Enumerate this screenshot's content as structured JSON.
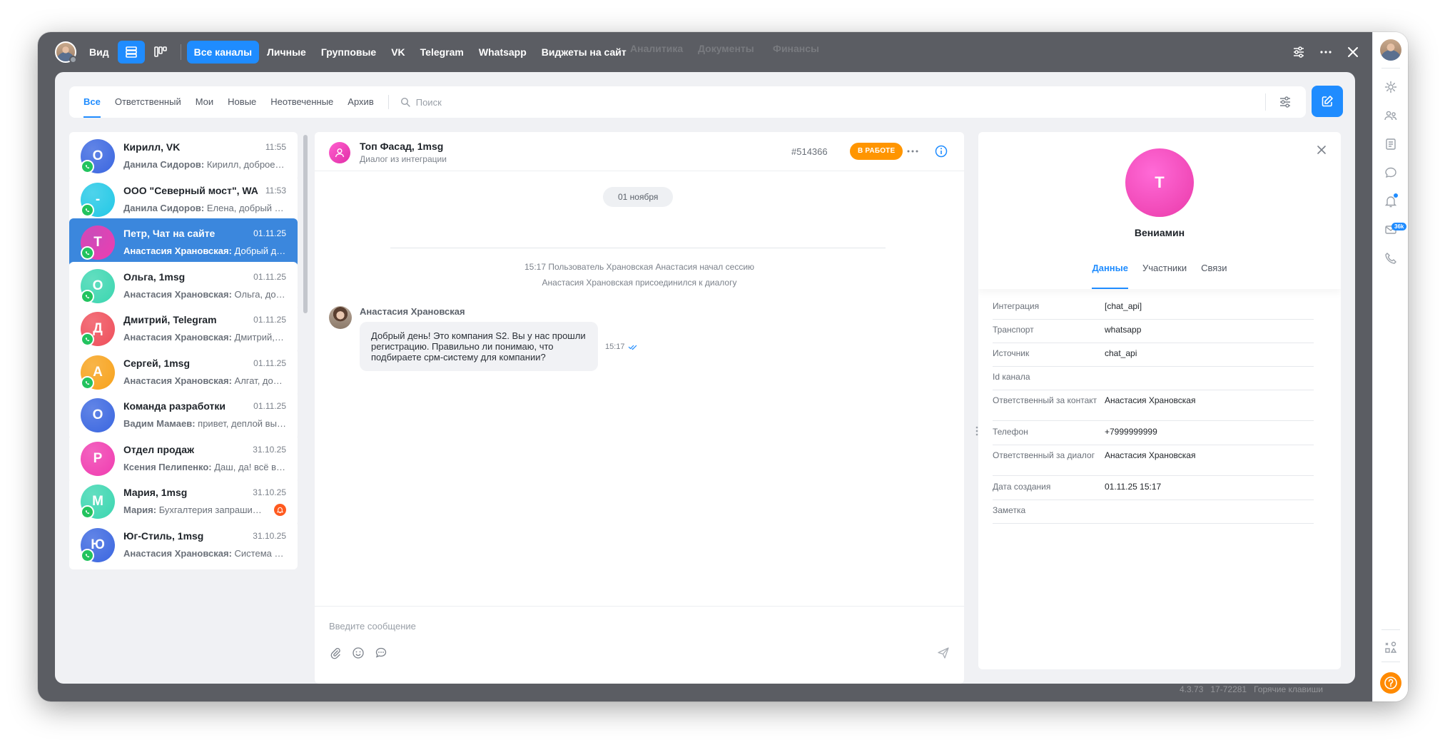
{
  "topbar": {
    "view_label": "Вид",
    "channels": [
      "Все каналы",
      "Личные",
      "Групповые",
      "VK",
      "Telegram",
      "Whatsapp",
      "Виджеты на сайт"
    ],
    "active_channel": "Все каналы"
  },
  "filters": {
    "tabs": [
      "Все",
      "Ответственный",
      "Мои",
      "Новые",
      "Неотвеченные",
      "Архив"
    ],
    "active_tab": "Все",
    "search_placeholder": "Поиск"
  },
  "chats": [
    {
      "initial": "О",
      "name": "Кирилл, VK",
      "time": "11:55",
      "author": "Данила Сидоров:",
      "text": " Кирилл, доброе утро",
      "color": "#3a66e0",
      "whatsapp": true
    },
    {
      "initial": "-",
      "name": "ООО \"Северный мост\", WA",
      "time": "11:53",
      "author": "Данила Сидоров:",
      "text": " Елена, добрый день",
      "color": "#22c8e6",
      "whatsapp": true
    },
    {
      "initial": "Т",
      "name": "Петр, Чат на сайте",
      "time": "01.11.25",
      "author": "Анастасия Храновская:",
      "text": " Добрый день",
      "color": "#f03cb0",
      "whatsapp": true,
      "active": true
    },
    {
      "initial": "О",
      "name": "Ольга, 1msg",
      "time": "01.11.25",
      "author": "Анастасия Храновская:",
      "text": " Ольга, добрый день",
      "color": "#3bd6b0",
      "whatsapp": true
    },
    {
      "initial": "Д",
      "name": "Дмитрий, Telegram",
      "time": "01.11.25",
      "author": "Анастасия Храновская:",
      "text": " Дмитрий, добрый день",
      "color": "#ef4e5a",
      "whatsapp": true
    },
    {
      "initial": "А",
      "name": "Сергей, 1msg",
      "time": "01.11.25",
      "author": "Анастасия Храновская:",
      "text": " Алгат, добрый день",
      "color": "#f7a21b",
      "whatsapp": true
    },
    {
      "initial": "О",
      "name": "Команда разработки",
      "time": "01.11.25",
      "author": "Вадим Мамаев:",
      "text": " привет, деплой выполнен",
      "color": "#3a66e0",
      "whatsapp": false
    },
    {
      "initial": "Р",
      "name": "Отдел продаж",
      "time": "31.10.25",
      "author": "Ксения Пелипенко:",
      "text": " Даш, да! всё в порядке",
      "color": "#f03cb0",
      "whatsapp": false
    },
    {
      "initial": "М",
      "name": "Мария, 1msg",
      "time": "31.10.25",
      "author": "Мария:",
      "text": " Бухгалтерия запрашивает",
      "color": "#3bd6b0",
      "whatsapp": true,
      "bell": true
    },
    {
      "initial": "Ю",
      "name": "Юг-Стиль, 1msg",
      "time": "31.10.25",
      "author": "Анастасия Храновская:",
      "text": " Система приняла",
      "color": "#3a66e0",
      "whatsapp": true
    }
  ],
  "conversation": {
    "title": "Топ Фасад, 1msg",
    "subtitle": "Диалог из интеграции",
    "id": "#514366",
    "status": "В РАБОТЕ",
    "date": "01 ноября",
    "system": [
      "15:17 Пользователь Храновская Анастасия начал сессию",
      "Анастасия Храновская присоединился к диалогу"
    ],
    "message": {
      "author": "Анастасия Храновская",
      "text": "Добрый день! Это компания S2. Вы у нас прошли регистрацию. Правильно ли понимаю, что подбираете срм-систему для компании?",
      "time": "15:17"
    },
    "composer_placeholder": "Введите сообщение"
  },
  "contact": {
    "initial": "Т",
    "name": "Вениамин",
    "tabs": [
      "Данные",
      "Участники",
      "Связи"
    ],
    "active_tab": "Данные",
    "fields": [
      {
        "label": "Интеграция",
        "value": "[chat_api]"
      },
      {
        "label": "Транспорт",
        "value": "whatsapp"
      },
      {
        "label": "Источник",
        "value": "chat_api"
      },
      {
        "label": "Id канала",
        "value": ""
      },
      {
        "label": "Ответственный за контакт",
        "value": "Анастасия Храновская"
      },
      {
        "label": "Телефон",
        "value": "+7999999999"
      },
      {
        "label": "Ответственный за диалог",
        "value": "Анастасия Храновская"
      },
      {
        "label": "Дата создания",
        "value": "01.11.25 15:17"
      },
      {
        "label": "Заметка",
        "value": ""
      }
    ]
  },
  "rail": {
    "mail_badge": "36k"
  },
  "footer": {
    "version": "4.3.73",
    "build": "17-72281",
    "hotkeys": "Горячие клавиши"
  },
  "colors": {
    "accent": "#1f8cff",
    "status": "#ff9500",
    "whatsapp": "#22c35e"
  }
}
